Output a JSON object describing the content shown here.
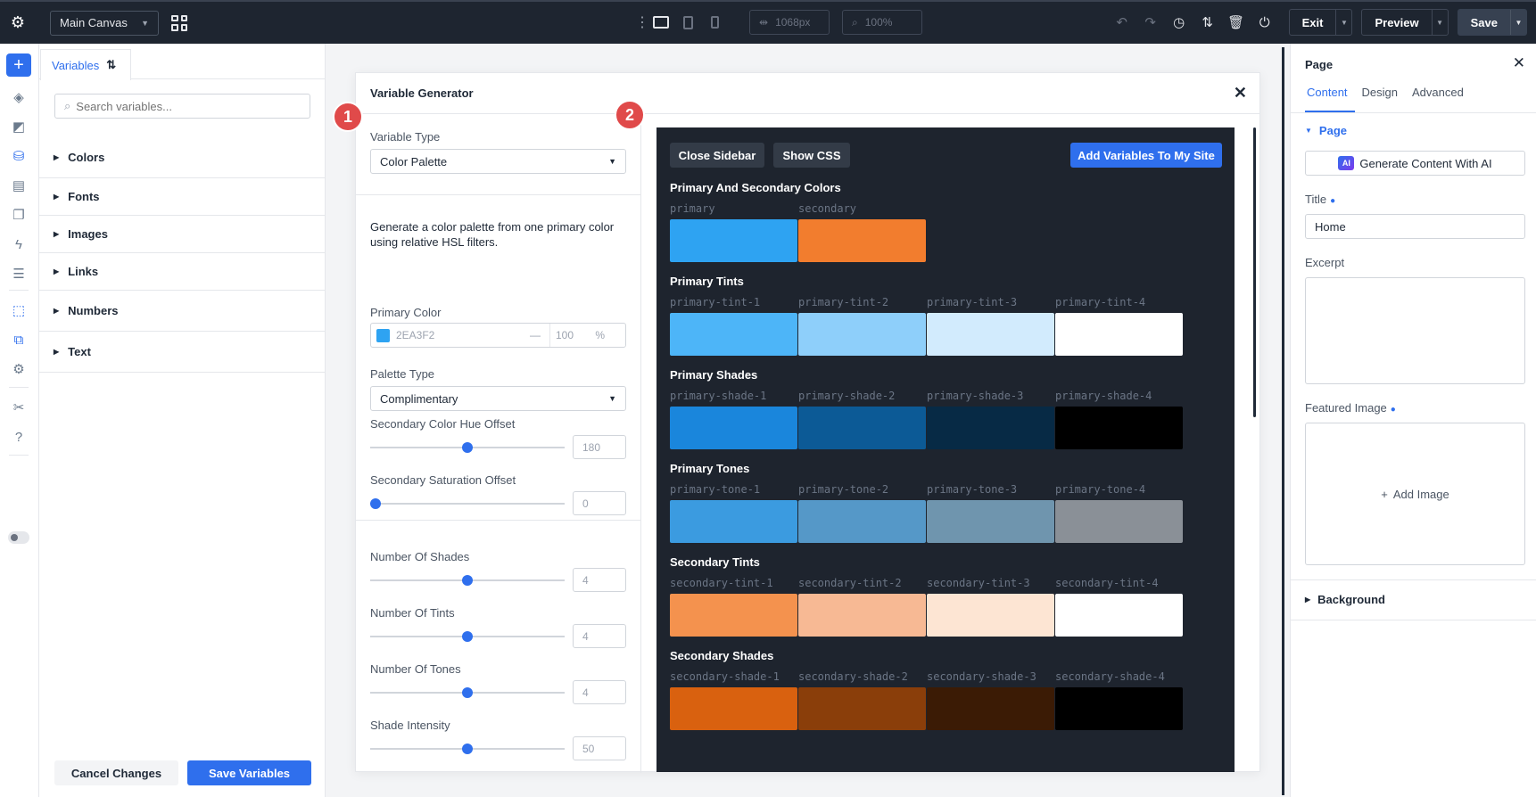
{
  "topbar": {
    "canvas_select": "Main Canvas",
    "width_value": "1068px",
    "zoom_value": "100%",
    "exit_label": "Exit",
    "preview_label": "Preview",
    "save_label": "Save"
  },
  "variables_panel": {
    "tab_label": "Variables",
    "search_placeholder": "Search variables...",
    "categories": [
      "Colors",
      "Fonts",
      "Images",
      "Links",
      "Numbers",
      "Text"
    ],
    "cancel_label": "Cancel Changes",
    "save_label": "Save Variables"
  },
  "generator": {
    "title": "Variable Generator",
    "variable_type_label": "Variable Type",
    "variable_type_value": "Color Palette",
    "description": "Generate a color palette from one primary color using relative HSL filters.",
    "primary_color_label": "Primary Color",
    "primary_color_hex": "2EA3F2",
    "primary_color_swatch": "#2ea3f2",
    "primary_color_opacity": "100",
    "opacity_unit": "%",
    "palette_type_label": "Palette Type",
    "palette_type_value": "Complimentary",
    "sliders": [
      {
        "label": "Secondary Color Hue Offset",
        "value": "180",
        "fraction": 0.5
      },
      {
        "label": "Secondary Saturation Offset",
        "value": "0",
        "fraction": 0.0
      },
      {
        "label": "Number Of Shades",
        "value": "4",
        "fraction": 0.5
      },
      {
        "label": "Number Of Tints",
        "value": "4",
        "fraction": 0.5
      },
      {
        "label": "Number Of Tones",
        "value": "4",
        "fraction": 0.5
      },
      {
        "label": "Shade Intensity",
        "value": "50",
        "fraction": 0.5
      }
    ],
    "steps": [
      "1",
      "2"
    ]
  },
  "preview": {
    "close_sidebar_label": "Close Sidebar",
    "show_css_label": "Show CSS",
    "add_variables_label": "Add Variables To My Site",
    "groups": [
      {
        "title": "Primary And Secondary Colors",
        "items": [
          {
            "name": "primary",
            "color": "#2ea3f2"
          },
          {
            "name": "secondary",
            "color": "#f27d2e"
          }
        ]
      },
      {
        "title": "Primary Tints",
        "items": [
          {
            "name": "primary-tint-1",
            "color": "#4db5f8"
          },
          {
            "name": "primary-tint-2",
            "color": "#8ecffa"
          },
          {
            "name": "primary-tint-3",
            "color": "#d2ebfd"
          },
          {
            "name": "primary-tint-4",
            "color": "#ffffff"
          }
        ]
      },
      {
        "title": "Primary Shades",
        "items": [
          {
            "name": "primary-shade-1",
            "color": "#1a86dc"
          },
          {
            "name": "primary-shade-2",
            "color": "#0c5a96"
          },
          {
            "name": "primary-shade-3",
            "color": "#072a45"
          },
          {
            "name": "primary-shade-4",
            "color": "#000000"
          }
        ]
      },
      {
        "title": "Primary Tones",
        "items": [
          {
            "name": "primary-tone-1",
            "color": "#3b9be0"
          },
          {
            "name": "primary-tone-2",
            "color": "#5598c8"
          },
          {
            "name": "primary-tone-3",
            "color": "#6f95ae"
          },
          {
            "name": "primary-tone-4",
            "color": "#8a9097"
          }
        ]
      },
      {
        "title": "Secondary Tints",
        "items": [
          {
            "name": "secondary-tint-1",
            "color": "#f4924e"
          },
          {
            "name": "secondary-tint-2",
            "color": "#f7b994"
          },
          {
            "name": "secondary-tint-3",
            "color": "#fde5d3"
          },
          {
            "name": "secondary-tint-4",
            "color": "#ffffff"
          }
        ]
      },
      {
        "title": "Secondary Shades",
        "items": [
          {
            "name": "secondary-shade-1",
            "color": "#d9610f"
          },
          {
            "name": "secondary-shade-2",
            "color": "#8a3e0a"
          },
          {
            "name": "secondary-shade-3",
            "color": "#3b1b05"
          },
          {
            "name": "secondary-shade-4",
            "color": "#000000"
          }
        ]
      }
    ]
  },
  "page_panel": {
    "title": "Page",
    "tabs": [
      "Content",
      "Design",
      "Advanced"
    ],
    "section_page": "Page",
    "ai_button": "Generate Content With AI",
    "ai_badge": "AI",
    "title_label": "Title",
    "title_value": "Home",
    "excerpt_label": "Excerpt",
    "featured_image_label": "Featured Image",
    "add_image_label": "Add Image",
    "section_background": "Background"
  },
  "colors": {
    "accent": "#2f6fed",
    "topbar_bg": "#1e2530",
    "preview_bg": "#1e242e",
    "step_badge": "#e04a4a"
  }
}
